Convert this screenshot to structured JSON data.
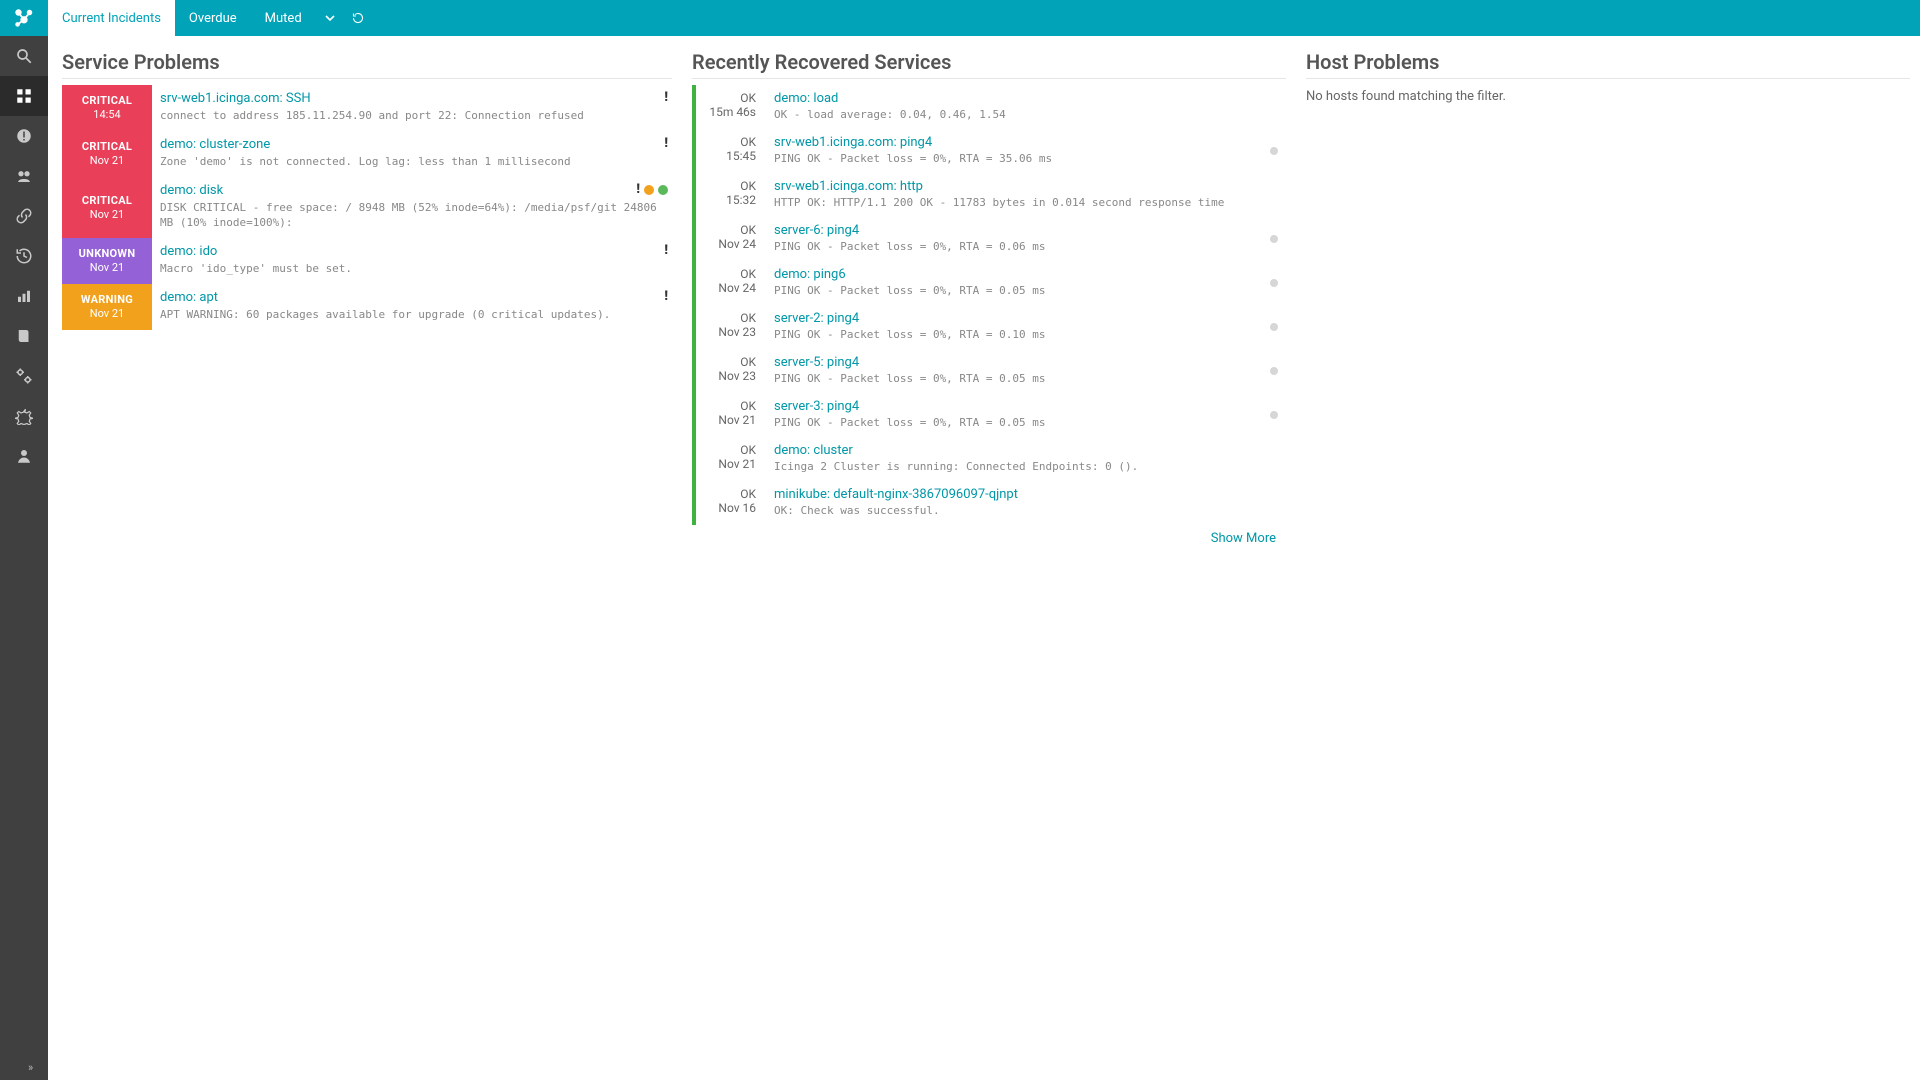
{
  "topbar": {
    "tabs": [
      {
        "label": "Current Incidents",
        "active": true
      },
      {
        "label": "Overdue",
        "active": false
      },
      {
        "label": "Muted",
        "active": false
      }
    ]
  },
  "rail": {
    "items": [
      {
        "name": "search-icon"
      },
      {
        "name": "dashboard-icon",
        "selected": true
      },
      {
        "name": "problems-icon"
      },
      {
        "name": "overview-icon"
      },
      {
        "name": "connections-icon"
      },
      {
        "name": "history-icon"
      },
      {
        "name": "reporting-icon"
      },
      {
        "name": "documentation-icon"
      },
      {
        "name": "configuration-icon"
      },
      {
        "name": "system-icon"
      },
      {
        "name": "user-icon"
      }
    ]
  },
  "sections": {
    "service_problems": "Service Problems",
    "recently_recovered": "Recently Recovered Services",
    "host_problems": "Host Problems"
  },
  "service_problems": [
    {
      "state": "CRITICAL",
      "time": "14:54",
      "title": "srv-web1.icinga.com: SSH",
      "msg": "connect to address 185.11.254.90 and port 22: Connection refused",
      "icons": [
        "bang"
      ]
    },
    {
      "state": "CRITICAL",
      "time": "Nov 21",
      "title": "demo: cluster-zone",
      "msg": "Zone 'demo' is not connected. Log lag: less than 1 millisecond",
      "icons": [
        "bang"
      ]
    },
    {
      "state": "CRITICAL",
      "time": "Nov 21",
      "title": "demo: disk",
      "msg": "DISK CRITICAL - free space: / 8948 MB (52% inode=64%): /media/psf/git 24806 MB (10% inode=100%):",
      "icons": [
        "bang",
        "dot-orange",
        "dot-green"
      ]
    },
    {
      "state": "UNKNOWN",
      "time": "Nov 21",
      "title": "demo: ido",
      "msg": "Macro 'ido_type' must be set.",
      "icons": [
        "bang"
      ]
    },
    {
      "state": "WARNING",
      "time": "Nov 21",
      "title": "demo: apt",
      "msg": "APT WARNING: 60 packages available for upgrade (0 critical updates).",
      "icons": [
        "bang"
      ]
    }
  ],
  "recently_recovered": [
    {
      "ok": "OK",
      "time": "15m 46s",
      "title": "demo: load",
      "msg": "OK - load average: 0.04, 0.46, 1.54",
      "dot": false
    },
    {
      "ok": "OK",
      "time": "15:45",
      "title": "srv-web1.icinga.com: ping4",
      "msg": "PING OK - Packet loss = 0%, RTA = 35.06 ms",
      "dot": true
    },
    {
      "ok": "OK",
      "time": "15:32",
      "title": "srv-web1.icinga.com: http",
      "msg": "HTTP OK: HTTP/1.1 200 OK - 11783 bytes in 0.014 second response time",
      "dot": false
    },
    {
      "ok": "OK",
      "time": "Nov 24",
      "title": "server-6: ping4",
      "msg": "PING OK - Packet loss = 0%, RTA = 0.06 ms",
      "dot": true
    },
    {
      "ok": "OK",
      "time": "Nov 24",
      "title": "demo: ping6",
      "msg": "PING OK - Packet loss = 0%, RTA = 0.05 ms",
      "dot": true
    },
    {
      "ok": "OK",
      "time": "Nov 23",
      "title": "server-2: ping4",
      "msg": "PING OK - Packet loss = 0%, RTA = 0.10 ms",
      "dot": true
    },
    {
      "ok": "OK",
      "time": "Nov 23",
      "title": "server-5: ping4",
      "msg": "PING OK - Packet loss = 0%, RTA = 0.05 ms",
      "dot": true
    },
    {
      "ok": "OK",
      "time": "Nov 21",
      "title": "server-3: ping4",
      "msg": "PING OK - Packet loss = 0%, RTA = 0.05 ms",
      "dot": true
    },
    {
      "ok": "OK",
      "time": "Nov 21",
      "title": "demo: cluster",
      "msg": "Icinga 2 Cluster is running: Connected Endpoints: 0 ().",
      "dot": false
    },
    {
      "ok": "OK",
      "time": "Nov 16",
      "title": "minikube: default-nginx-3867096097-qjnpt",
      "msg": "OK: Check was successful.",
      "dot": false
    }
  ],
  "host_problems": {
    "empty_text": "No hosts found matching the filter."
  },
  "show_more": "Show More"
}
